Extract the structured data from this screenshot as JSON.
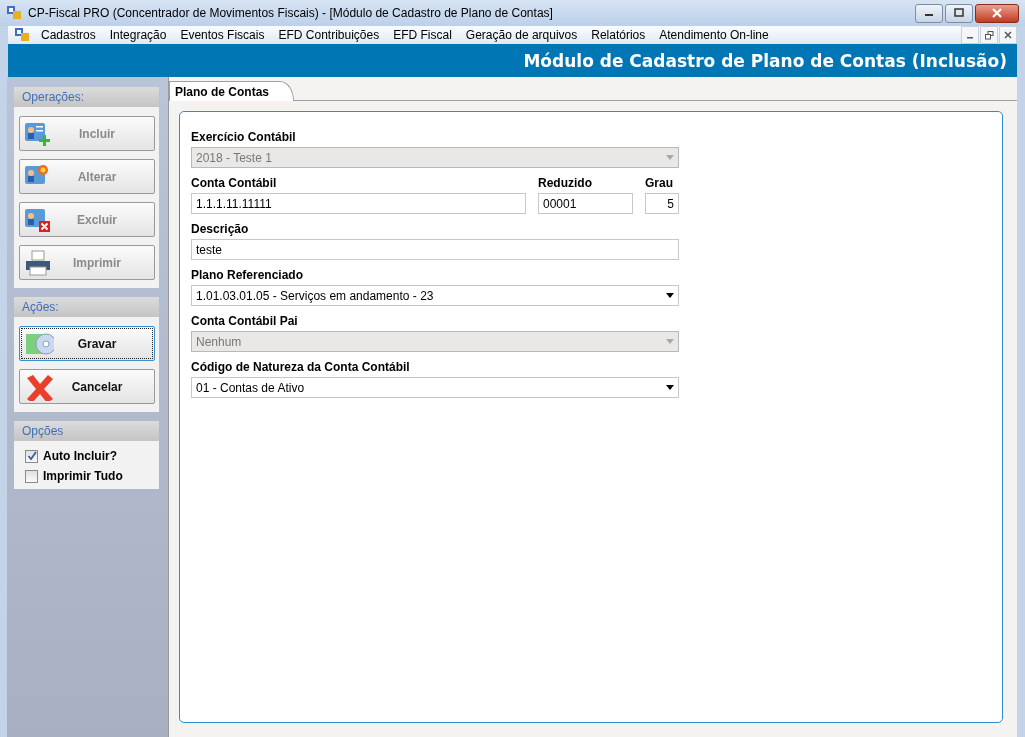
{
  "window": {
    "title": "CP-Fiscal PRO (Concentrador de Movimentos Fiscais) - [Módulo de Cadastro de Plano de Contas]"
  },
  "menu": {
    "items": [
      "Cadastros",
      "Integração",
      "Eventos Fiscais",
      "EFD Contribuições",
      "EFD Fiscal",
      "Geração de arquivos",
      "Relatórios",
      "Atendimento On-line"
    ]
  },
  "header": {
    "title": "Módulo de Cadastro de Plano de Contas (Inclusão)"
  },
  "sidebar": {
    "sections": [
      {
        "title": "Operações:",
        "kind": "buttons",
        "buttons": [
          {
            "label": "Incluir",
            "disabled": true,
            "focused": false
          },
          {
            "label": "Alterar",
            "disabled": true,
            "focused": false
          },
          {
            "label": "Excluir",
            "disabled": true,
            "focused": false
          },
          {
            "label": "Imprimir",
            "disabled": true,
            "focused": false
          }
        ]
      },
      {
        "title": "Ações:",
        "kind": "buttons",
        "buttons": [
          {
            "label": "Gravar",
            "disabled": false,
            "focused": true
          },
          {
            "label": "Cancelar",
            "disabled": false,
            "focused": false
          }
        ]
      },
      {
        "title": "Opções",
        "kind": "checks",
        "items": [
          {
            "label": "Auto Incluir?",
            "checked": true
          },
          {
            "label": "Imprimir Tudo",
            "checked": false
          }
        ]
      }
    ]
  },
  "tabs": [
    {
      "label": "Plano de Contas",
      "selected": true
    }
  ],
  "form": {
    "rows": [
      [
        {
          "label": "Exercício Contábil",
          "kind": "combo",
          "value": "2018 - Teste 1",
          "disabled": true
        }
      ],
      [
        {
          "label": "Conta Contábil",
          "kind": "text",
          "value": "1.1.1.11.11111",
          "disabled": false
        },
        {
          "label": "Reduzido",
          "kind": "text",
          "value": "00001",
          "disabled": false
        },
        {
          "label": "Grau",
          "kind": "number",
          "value": "5",
          "disabled": false
        }
      ],
      [
        {
          "label": "Descrição",
          "kind": "text",
          "value": "teste",
          "disabled": false
        }
      ],
      [
        {
          "label": "Plano Referenciado",
          "kind": "combo",
          "value": "1.01.03.01.05 - Serviços em andamento - 23",
          "disabled": false
        }
      ],
      [
        {
          "label": "Conta Contábil Pai",
          "kind": "combo",
          "value": "Nenhum",
          "disabled": true
        }
      ],
      [
        {
          "label": "Código de Natureza da Conta Contábil",
          "kind": "combo",
          "value": "01 - Contas de Ativo",
          "disabled": false
        }
      ]
    ]
  }
}
